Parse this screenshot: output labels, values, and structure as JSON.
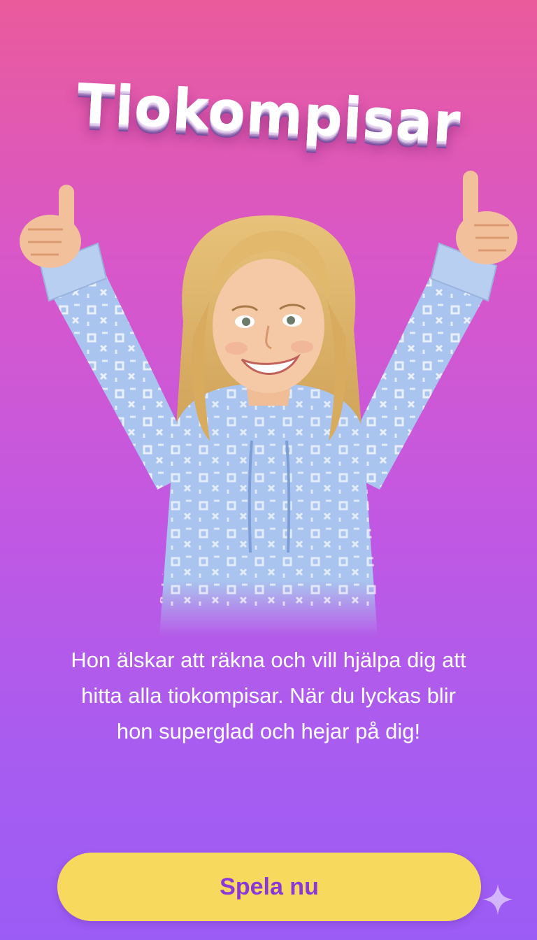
{
  "app": {
    "title": "Tiokompisar"
  },
  "intro": {
    "description": "Hon älskar att räkna och vill hjälpa dig att hitta alla tiokompisar. När du lyckas blir hon superglad och hejar på dig!"
  },
  "actions": {
    "play_label": "Spela nu"
  },
  "icons": {
    "corner": "sparkle-icon"
  },
  "colors": {
    "gradient_top": "#ea5b9c",
    "gradient_bottom": "#9b5cf5",
    "button_bg": "#f6d95d",
    "button_text": "#8a38d8"
  }
}
